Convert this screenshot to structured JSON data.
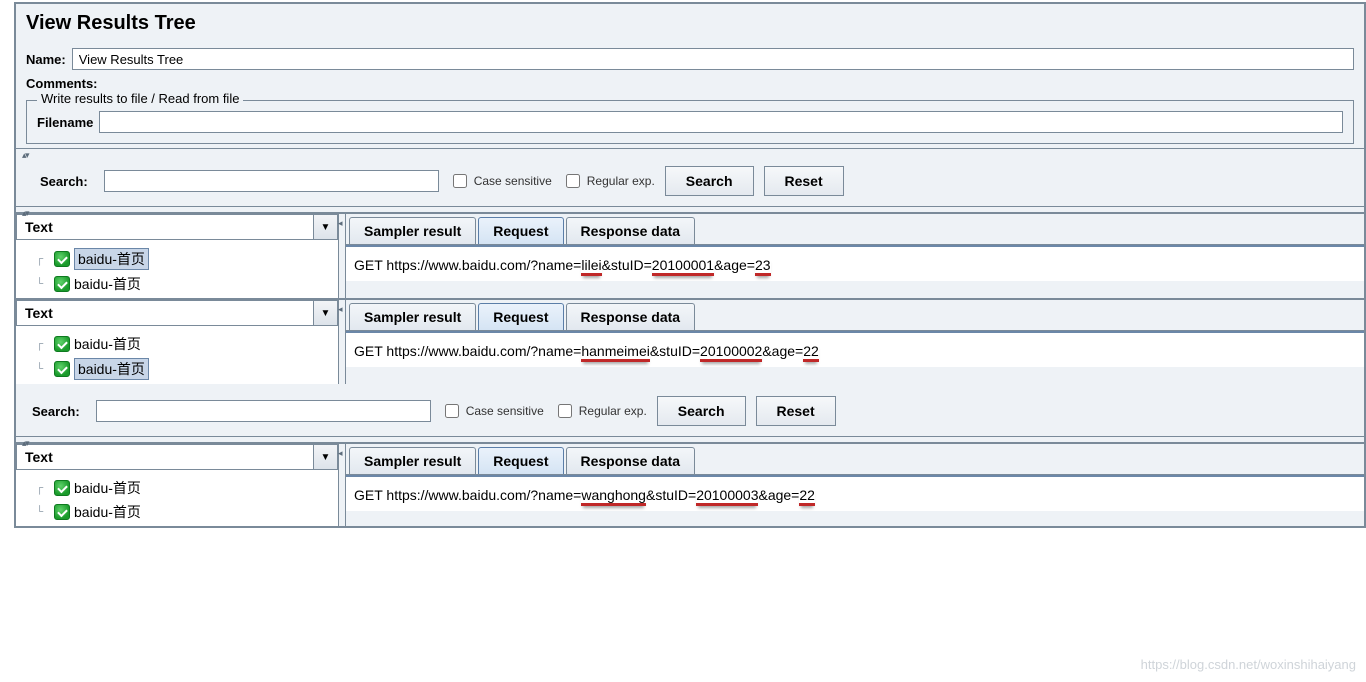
{
  "header": {
    "title": "View Results Tree",
    "name_label": "Name:",
    "name_value": "View Results Tree",
    "comments_label": "Comments:"
  },
  "file_group": {
    "legend": "Write results to file / Read from file",
    "filename_label": "Filename"
  },
  "search": {
    "label": "Search:",
    "case_label": "Case sensitive",
    "regex_label": "Regular exp.",
    "search_btn": "Search",
    "reset_btn": "Reset"
  },
  "combo_label": "Text",
  "tabs": {
    "sampler": "Sampler result",
    "request": "Request",
    "response": "Response data"
  },
  "panels": [
    {
      "tree": [
        {
          "label": "baidu-首页",
          "selected": true
        },
        {
          "label": "baidu-首页",
          "selected": false
        }
      ],
      "req_prefix": "GET https://www.baidu.com/?name=",
      "name": "lilei",
      "stuid_lbl": "&stuID=",
      "stuid": "20100001",
      "age_lbl": "&age=",
      "age": "23"
    },
    {
      "tree": [
        {
          "label": "baidu-首页",
          "selected": false
        },
        {
          "label": "baidu-首页",
          "selected": true
        }
      ],
      "req_prefix": "GET https://www.baidu.com/?name=",
      "name": "hanmeimei",
      "stuid_lbl": "&stuID=",
      "stuid": "20100002",
      "age_lbl": "&age=",
      "age": "22"
    },
    {
      "tree": [
        {
          "label": "baidu-首页",
          "selected": false
        },
        {
          "label": "baidu-首页",
          "selected": false
        }
      ],
      "req_prefix": "GET https://www.baidu.com/?name=",
      "name": "wanghong",
      "stuid_lbl": "&stuID=",
      "stuid": "20100003",
      "age_lbl": "&age=",
      "age": "22"
    }
  ],
  "watermark": "https://blog.csdn.net/woxinshihaiyang"
}
